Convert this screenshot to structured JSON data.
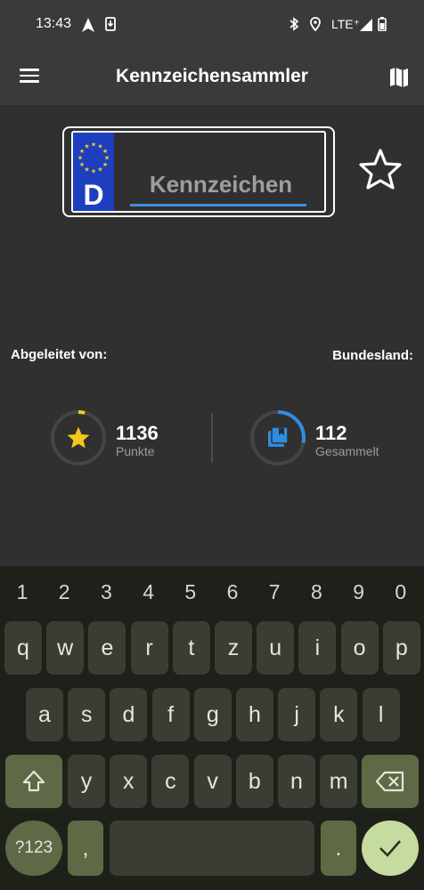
{
  "status_bar": {
    "time": "13:43",
    "network": "LTE⁺"
  },
  "app_bar": {
    "title": "Kennzeichensammler",
    "menu_icon": "hamburger-menu-icon",
    "map_icon": "map-icon"
  },
  "plate": {
    "country_code": "D",
    "placeholder": "Kennzeichen",
    "value": "",
    "eu_band_color": "#1d3fbf",
    "underline_color": "#3d8fe0"
  },
  "favorite_icon": "star-outline-icon",
  "labels": {
    "derived_from": "Abgeleitet von:",
    "state": "Bundesland:"
  },
  "stats": {
    "points": {
      "value": "1136",
      "label": "Punkte",
      "progress": 0.04,
      "color": "#f2c81d",
      "icon": "star-icon"
    },
    "collected": {
      "value": "112",
      "label": "Gesammelt",
      "progress": 0.28,
      "color": "#2f8de4",
      "icon": "collection-icon"
    }
  },
  "keyboard": {
    "numbers": [
      "1",
      "2",
      "3",
      "4",
      "5",
      "6",
      "7",
      "8",
      "9",
      "0"
    ],
    "row1": [
      "q",
      "w",
      "e",
      "r",
      "t",
      "z",
      "u",
      "i",
      "o",
      "p"
    ],
    "row2": [
      "a",
      "s",
      "d",
      "f",
      "g",
      "h",
      "j",
      "k",
      "l"
    ],
    "row3": [
      "y",
      "x",
      "c",
      "v",
      "b",
      "n",
      "m"
    ],
    "symbols_key": "?123",
    "comma": ",",
    "period": ".",
    "shift_icon": "shift-icon",
    "backspace_icon": "backspace-icon",
    "enter_icon": "checkmark-icon"
  }
}
